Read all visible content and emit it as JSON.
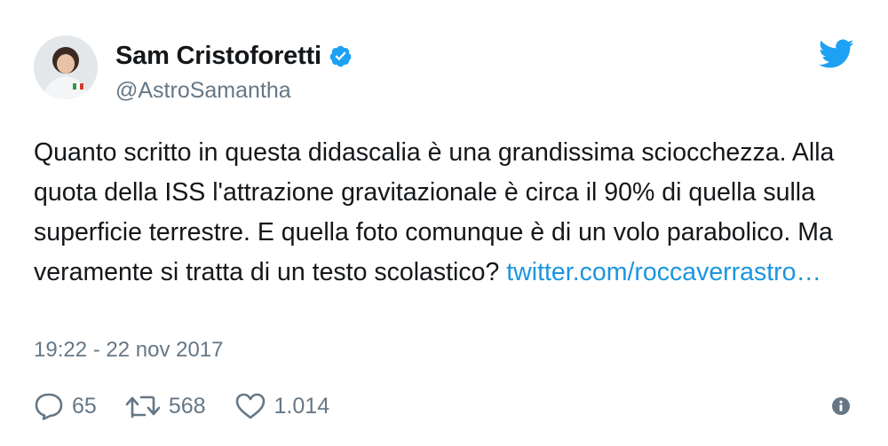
{
  "author": {
    "display_name": "Sam Cristoforetti",
    "handle": "@AstroSamantha",
    "verified": true,
    "avatar_icon": "astronaut-avatar"
  },
  "tweet": {
    "text": "Quanto scritto in questa didascalia è una grandissima sciocchezza. Alla quota della ISS l'attrazione gravitazionale è circa il 90% di quella sulla superficie terrestre. E quella foto comunque è di un volo parabolico. Ma veramente si tratta di un testo scolastico? ",
    "link_text": "twitter.com/roccaverrastro…",
    "timestamp": "19:22 - 22 nov 2017"
  },
  "actions": {
    "replies": "65",
    "retweets": "568",
    "likes": "1.014"
  },
  "icons": {
    "brand": "twitter-bird-icon",
    "verified": "verified-badge-icon",
    "reply": "reply-icon",
    "retweet": "retweet-icon",
    "like": "heart-icon",
    "info": "info-icon"
  },
  "colors": {
    "brand_blue": "#1da1f2",
    "link_blue": "#1b95e0",
    "muted_gray": "#657786",
    "text_dark": "#14171a"
  }
}
